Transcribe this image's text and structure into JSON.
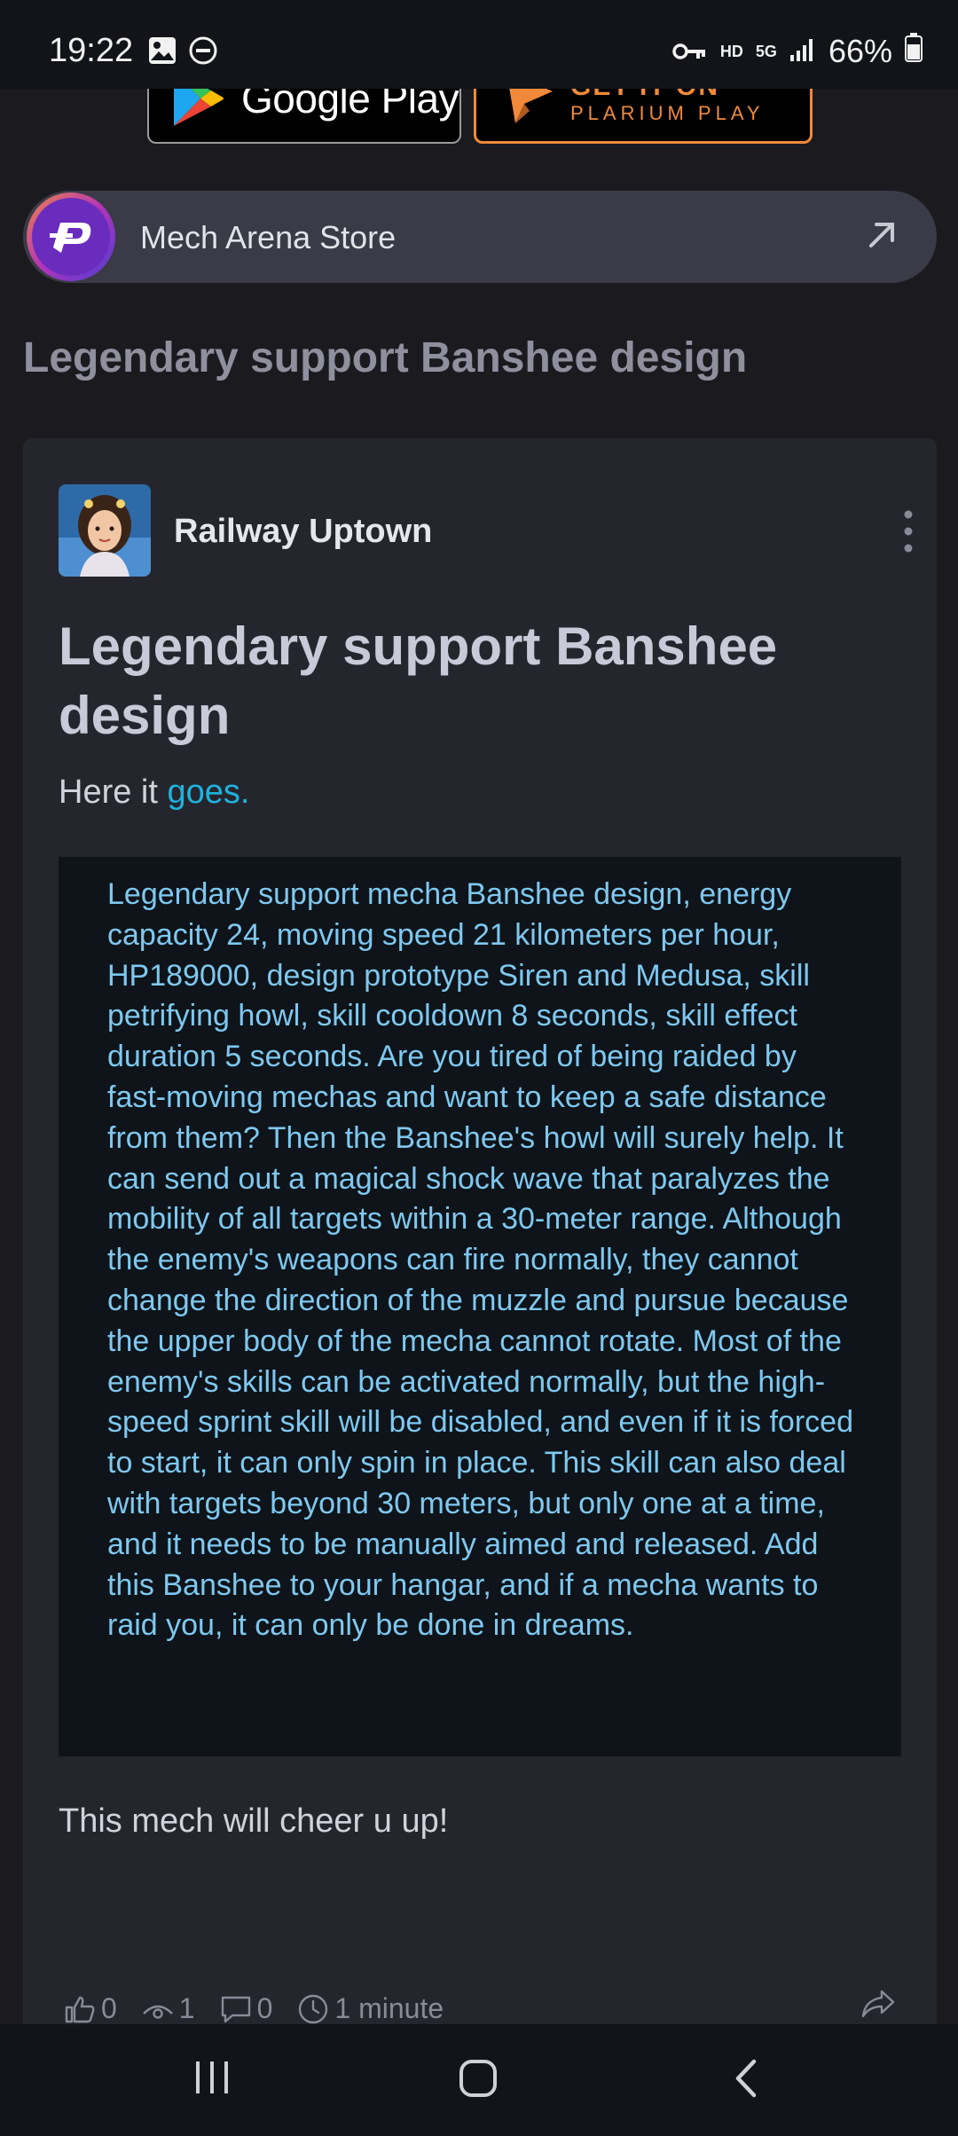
{
  "status": {
    "time": "19:22",
    "net_hd": "HD",
    "net_5g": "5G",
    "battery": "66%"
  },
  "badges": {
    "google_play": "Google Play",
    "plarium_top": "GET IT ON",
    "plarium_bottom": "PLARIUM PLAY"
  },
  "store": {
    "label": "Mech Arena Store"
  },
  "page_heading": "Legendary support Banshee design",
  "post": {
    "author": "Railway Uptown",
    "title": "Legendary support Banshee design",
    "intro_prefix": "Here it ",
    "intro_link": "goes.",
    "quote": "Legendary support mecha Banshee design, energy capacity 24, moving speed 21 kilometers per hour, HP189000, design prototype Siren and Medusa, skill petrifying howl, skill cooldown 8 seconds, skill effect duration 5 seconds. Are you tired of being raided by fast-moving mechas and want to keep a safe distance from them? Then the Banshee's howl will surely help. It can send out a magical shock wave that paralyzes the mobility of all targets within a 30-meter range. Although the enemy's weapons can fire normally, they cannot change the direction of the muzzle and pursue because the upper body of the mecha cannot rotate. Most of the enemy's skills can be activated normally, but the high-speed sprint skill will be disabled, and even if it is forced to start, it can only spin in place. This skill can also deal with targets beyond 30 meters, but only one at a time, and it needs to be manually aimed and released. Add this Banshee to your hangar, and if a mecha wants to raid you, it can only be done in dreams.",
    "closing": "This mech will cheer u up!",
    "stats": {
      "likes": "0",
      "views": "1",
      "comments": "0",
      "time": "1 minute"
    }
  },
  "colors": {
    "background": "#1b1b1f",
    "card": "#25252d",
    "quote_bg": "#0e1419",
    "quote_text": "#7fc8f0",
    "link": "#1fb3dd",
    "plarium_orange": "#f08a3a"
  }
}
